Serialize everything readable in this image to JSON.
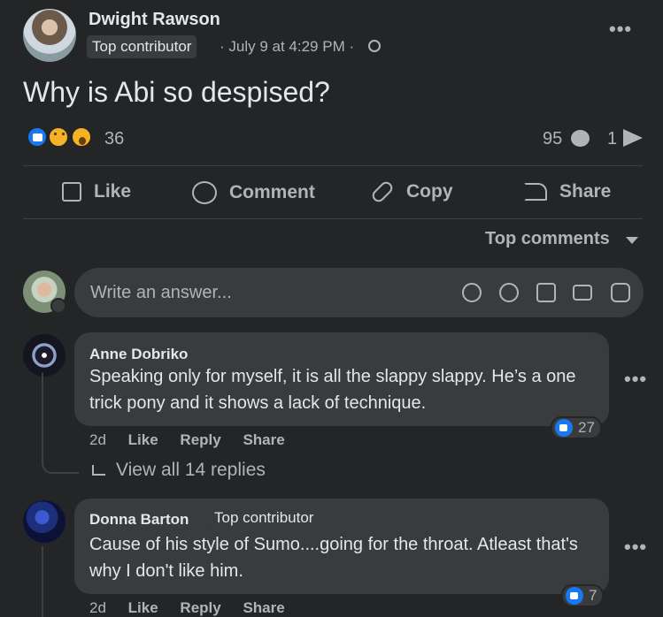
{
  "post": {
    "author": "Dwight Rawson",
    "badge": "Top contributor",
    "meta": "· July 9 at 4:29 PM ·",
    "more": "•••",
    "title": "Why is Abi so despised?",
    "reaction_count": "36",
    "comment_count": "95",
    "share_count": "1"
  },
  "actions": {
    "like": "Like",
    "comment": "Comment",
    "copy": "Copy",
    "share": "Share"
  },
  "sort": {
    "label": "Top comments"
  },
  "answer": {
    "placeholder": "Write an answer..."
  },
  "comments": [
    {
      "name": "Anne Dobriko",
      "text": "Speaking only for myself, it is all the slappy slappy. He’s a one trick pony and it shows a lack of technique.",
      "time": "2d",
      "like": "Like",
      "reply": "Reply",
      "share": "Share",
      "likes": "27",
      "view_replies": "View all 14 replies",
      "more": "•••"
    },
    {
      "name": "Donna Barton",
      "badge": "Top contributor",
      "text": "Cause of his style of Sumo....going for the throat. Atleast that's why I don't like him.",
      "time": "2d",
      "like": "Like",
      "reply": "Reply",
      "share": "Share",
      "likes": "7",
      "more": "•••"
    }
  ],
  "colors": {
    "background": "#242526",
    "surface": "#3a3b3c",
    "text": "#e4e6eb",
    "secondary": "#b0b3b8",
    "accent": "#1877f2"
  }
}
